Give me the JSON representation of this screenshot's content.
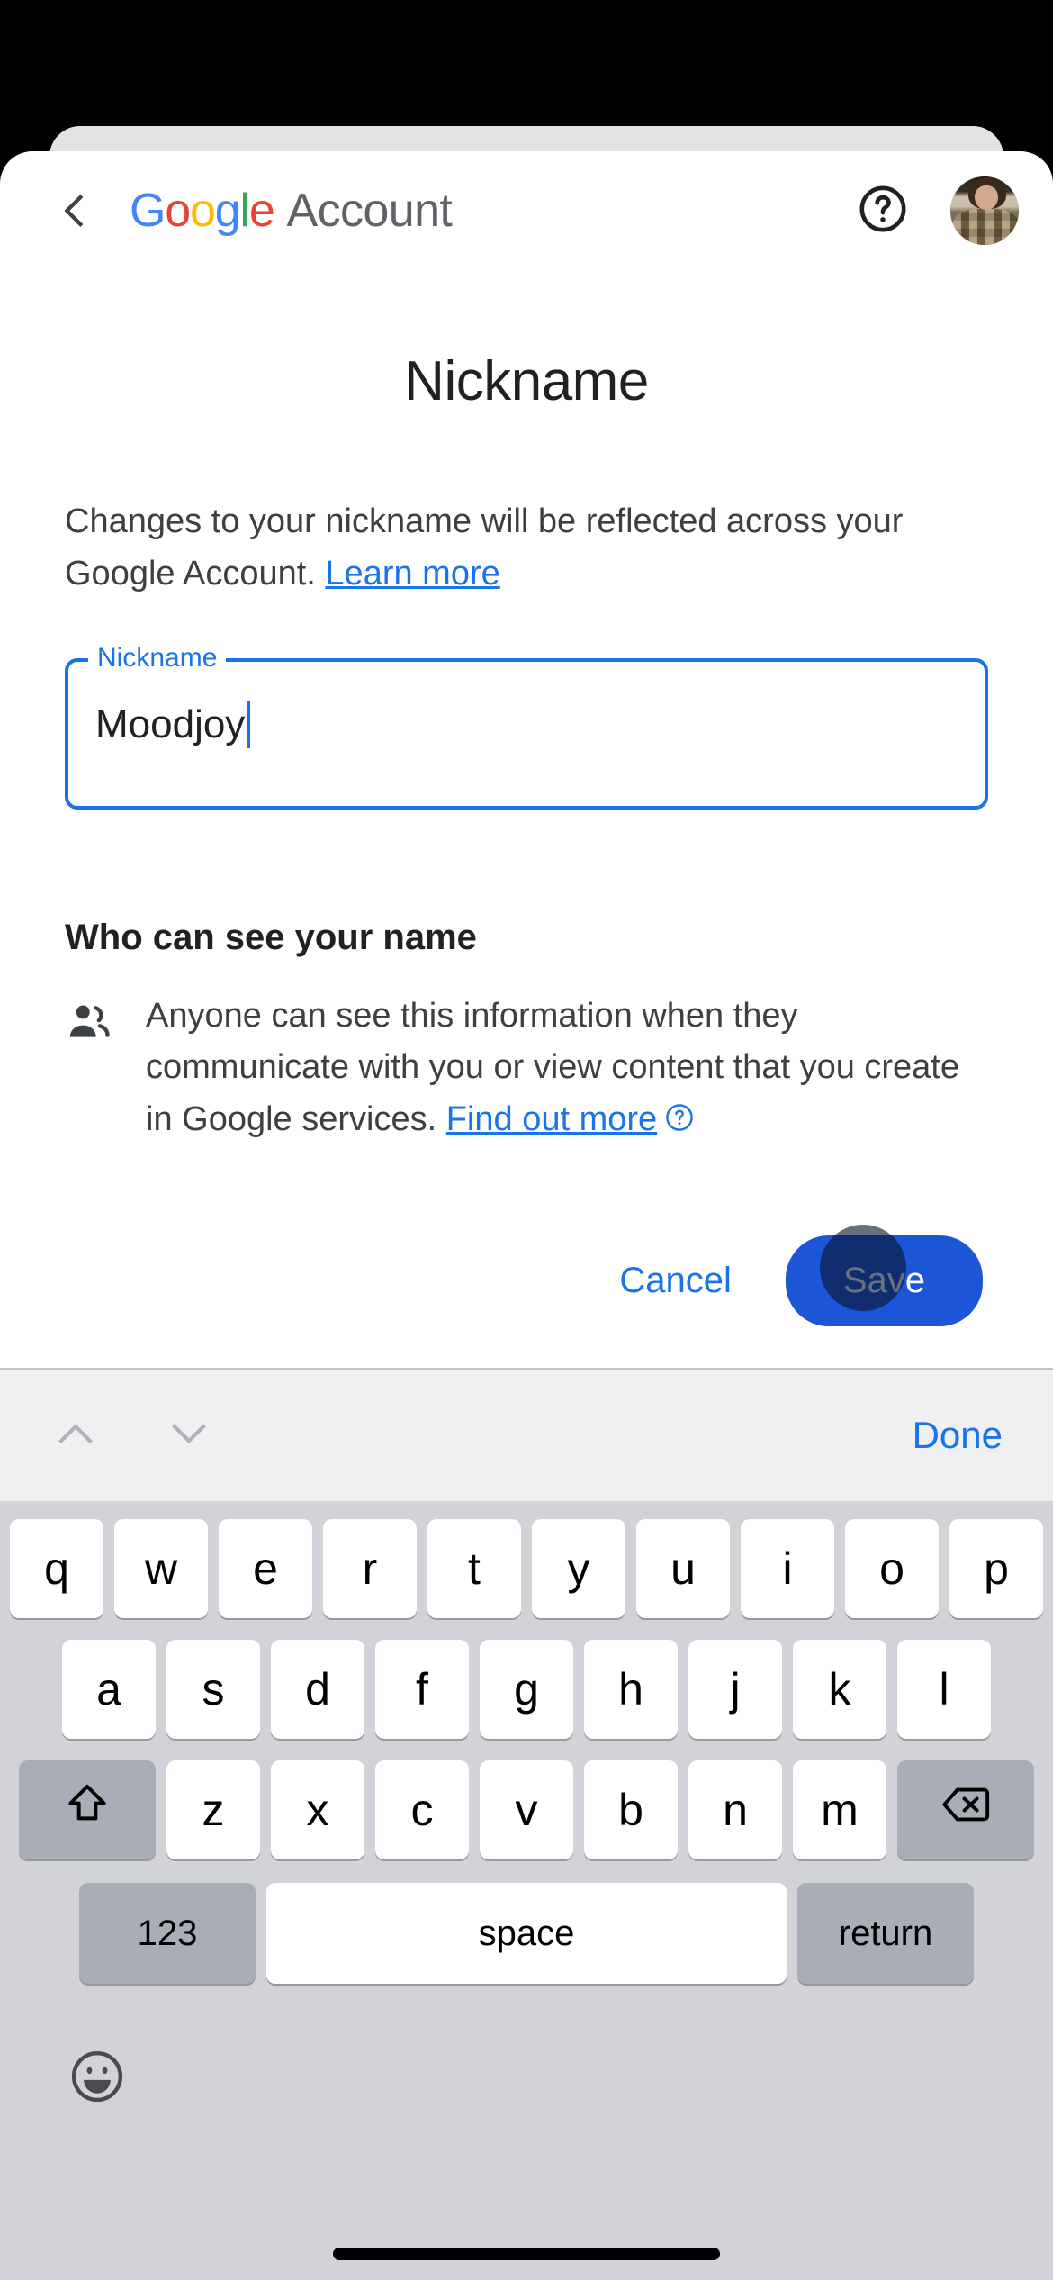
{
  "appbar": {
    "back_label": "Back",
    "brand_logo_letters": [
      "G",
      "o",
      "o",
      "g",
      "l",
      "e"
    ],
    "brand_word": "Account",
    "help_label": "Help",
    "avatar_label": "Google Account profile photo"
  },
  "page": {
    "title": "Nickname",
    "description_text": "Changes to your nickname will be reflected across your Google Account. ",
    "description_link": "Learn more"
  },
  "field": {
    "label": "Nickname",
    "value": "Moodjoy",
    "placeholder": "Nickname"
  },
  "visibility": {
    "heading": "Who can see your name",
    "body_text": "Anyone can see this information when they communicate with you or view content that you create in Google services. ",
    "body_link": "Find out more"
  },
  "actions": {
    "cancel_label": "Cancel",
    "save_label": "Save"
  },
  "keyboard": {
    "done_label": "Done",
    "row1": [
      "q",
      "w",
      "e",
      "r",
      "t",
      "y",
      "u",
      "i",
      "o",
      "p"
    ],
    "row2": [
      "a",
      "s",
      "d",
      "f",
      "g",
      "h",
      "j",
      "k",
      "l"
    ],
    "row3": [
      "z",
      "x",
      "c",
      "v",
      "b",
      "n",
      "m"
    ],
    "shift_label": "shift",
    "backspace_label": "delete",
    "numbers_label": "123",
    "space_label": "space",
    "return_label": "return",
    "emoji_label": "Emoji"
  },
  "colors": {
    "accent_blue": "#1a73e8",
    "save_button_blue": "#1a56d6",
    "google_blue": "#4285f4",
    "google_red": "#ea4335",
    "google_yellow": "#fbbc05",
    "google_green": "#34a853",
    "keyboard_bg": "#d1d3d9",
    "key_white": "#ffffff",
    "key_gray": "#a9adb8"
  }
}
